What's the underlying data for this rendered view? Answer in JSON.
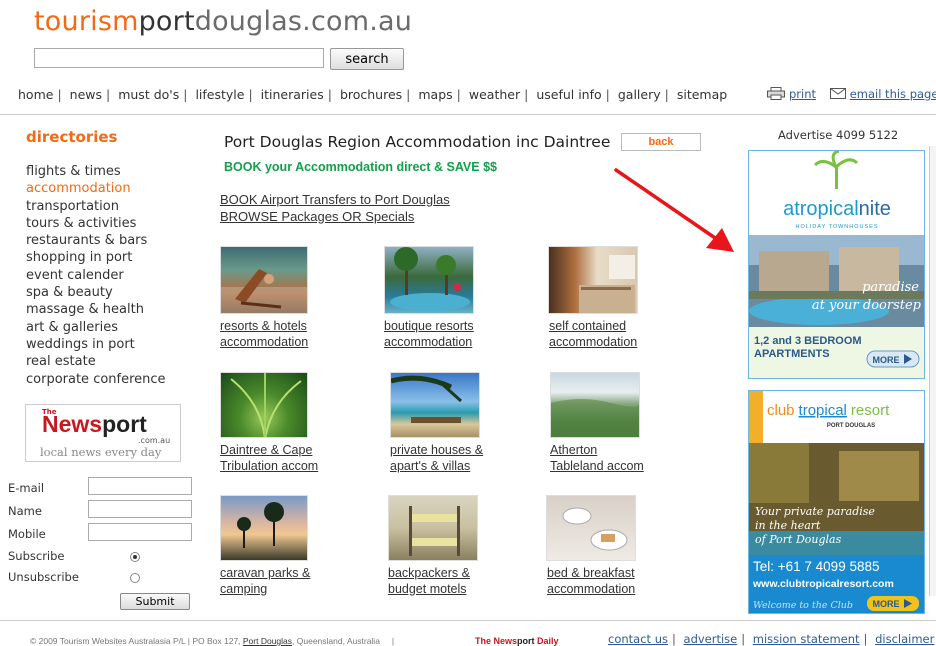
{
  "header": {
    "logo": {
      "part1": "tourism",
      "part2": "port",
      "part3": "douglas.com.au"
    },
    "search": {
      "placeholder": "",
      "button_label": "search"
    }
  },
  "top_nav": [
    "home",
    "news",
    "must do's",
    "lifestyle",
    "itineraries",
    "brochures",
    "maps",
    "weather",
    "useful info",
    "gallery",
    "sitemap"
  ],
  "utility_links": {
    "print": "print",
    "email": "email this page"
  },
  "sidebar": {
    "title": "directories",
    "items": [
      {
        "label": "flights & times",
        "active": false
      },
      {
        "label": "accommodation",
        "active": true
      },
      {
        "label": "transportation",
        "active": false
      },
      {
        "label": "tours & activities",
        "active": false
      },
      {
        "label": "restaurants & bars",
        "active": false
      },
      {
        "label": "shopping in port",
        "active": false
      },
      {
        "label": "event calender",
        "active": false
      },
      {
        "label": "spa & beauty",
        "active": false
      },
      {
        "label": "massage & health",
        "active": false
      },
      {
        "label": "art & galleries",
        "active": false
      },
      {
        "label": "weddings in port",
        "active": false
      },
      {
        "label": "real estate",
        "active": false
      },
      {
        "label": "corporate conference",
        "active": false
      }
    ],
    "newsport": {
      "the": "The",
      "news": "News",
      "port": "port",
      "domain": ".com.au",
      "tagline": "local news every day"
    },
    "form": {
      "email_label": "E-mail",
      "name_label": "Name",
      "mobile_label": "Mobile",
      "subscribe_label": "Subscribe",
      "unsubscribe_label": "Unsubscribe",
      "selected": "Subscribe",
      "submit_label": "Submit"
    }
  },
  "main": {
    "title": "Port Douglas Region Accommodation inc Daintree",
    "book_direct": "BOOK your Accommodation direct & SAVE $$",
    "back_label": "back",
    "links": [
      "BOOK Airport Transfers to Port Douglas",
      "BROWSE Packages OR Specials"
    ],
    "categories": [
      {
        "line1": "resorts & hotels",
        "line2": "accommodation"
      },
      {
        "line1": "boutique resorts",
        "line2": "accommodation"
      },
      {
        "line1": "self contained",
        "line2": "accommodation"
      },
      {
        "line1": "Daintree & Cape",
        "line2": "Tribulation accom"
      },
      {
        "line1": "private houses &",
        "line2": "apart's & villas"
      },
      {
        "line1": "Atherton",
        "line2": "Tableland accom"
      },
      {
        "line1": "caravan parks &",
        "line2": "camping"
      },
      {
        "line1": "backpackers &",
        "line2": "budget motels"
      },
      {
        "line1": "bed & breakfast",
        "line2": "accommodation"
      }
    ]
  },
  "right": {
    "advertise": "Advertise 4099 5122",
    "ad1": {
      "brand_a": "a",
      "brand_tropical": "tropical",
      "brand_nite": "nite",
      "sub": "HOLIDAY TOWNHOUSES",
      "slogan1": "paradise",
      "slogan2": "at your doorstep",
      "rooms1": "1,2 and 3 BEDROOM",
      "rooms2": "APARTMENTS",
      "more": "MORE"
    },
    "ad2": {
      "brand_club": "club",
      "brand_tropical": "tropical",
      "brand_resort": "resort",
      "sub": "PORT DOUGLAS",
      "script1": "Your private paradise",
      "script2": "in the heart",
      "script3": "of Port Douglas",
      "tel": "Tel: +61 7 4099 5885",
      "url": "www.clubtropicalresort.com",
      "welcome": "Welcome to the Club",
      "more": "MORE"
    }
  },
  "footer": {
    "copyright_pre": "© 2009 Tourism Websites Australasia P/L  |  PO Box 127, ",
    "copyright_pd": "Port Douglas",
    "copyright_post": ", Queensland, Australia",
    "newsport_a": "The News",
    "newsport_b": "port",
    "newsport_c": " Daily",
    "links": [
      "contact us",
      "advertise",
      "mission statement",
      "disclaimer"
    ]
  },
  "colors": {
    "brand_orange": "#f26a13",
    "green_text": "#13a04a",
    "link_blue": "#2d5c9a",
    "ad_border": "#6bb7e0",
    "arrow_red": "#e8151b"
  }
}
